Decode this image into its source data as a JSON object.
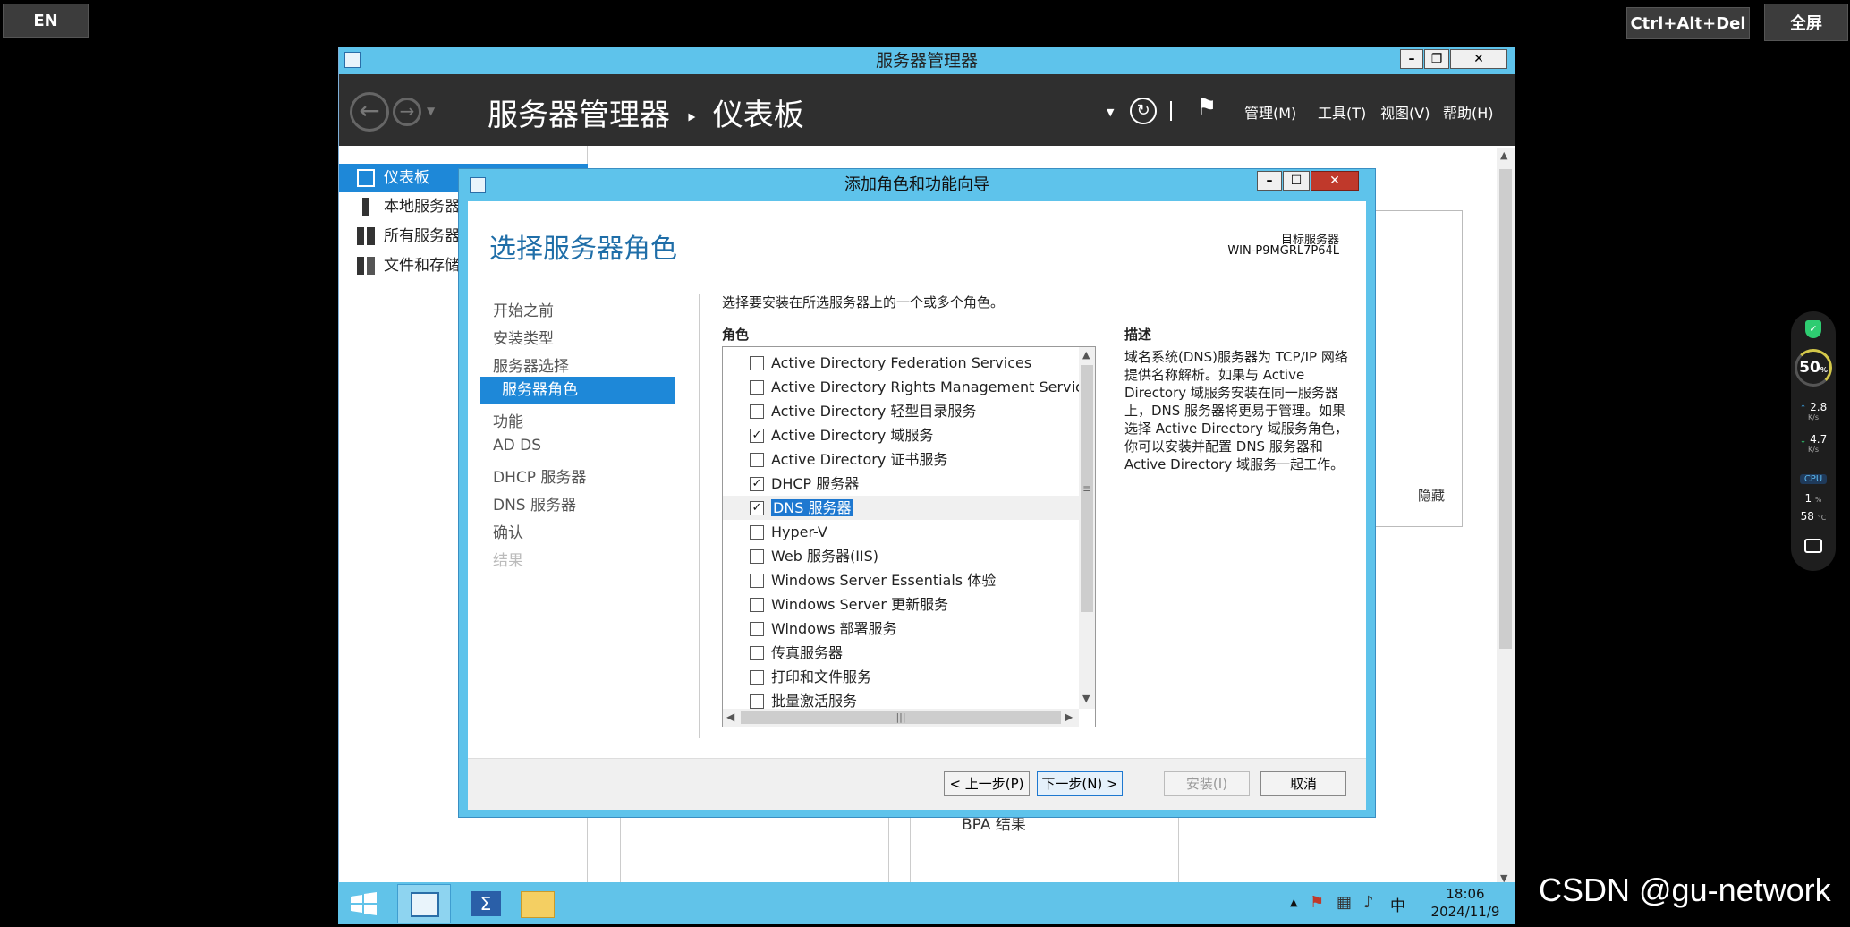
{
  "remote_bar": {
    "lang": "EN",
    "cad": "Ctrl+Alt+Del",
    "fullscreen": "全屏"
  },
  "server_manager": {
    "title": "服务器管理器",
    "breadcrumb_root": "服务器管理器",
    "breadcrumb_sep": "‣",
    "breadcrumb_page": "仪表板",
    "menus": [
      "管理(M)",
      "工具(T)",
      "视图(V)",
      "帮助(H)"
    ],
    "sidebar": [
      "仪表板",
      "本地服务器",
      "所有服务器",
      "文件和存储"
    ],
    "hide_label": "隐藏",
    "bpa_label": "BPA 结果"
  },
  "dialog": {
    "title": "添加角色和功能向导",
    "heading": "选择服务器角色",
    "target_label": "目标服务器",
    "target_value": "WIN-P9MGRL7P64L",
    "steps": [
      "开始之前",
      "安装类型",
      "服务器选择",
      "服务器角色",
      "功能",
      "AD DS",
      "DHCP 服务器",
      "DNS 服务器",
      "确认",
      "结果"
    ],
    "instruction": "选择要安装在所选服务器上的一个或多个角色。",
    "roles_header": "角色",
    "roles": [
      {
        "label": "Active Directory Federation Services",
        "checked": false
      },
      {
        "label": "Active Directory Rights Management Services",
        "checked": false
      },
      {
        "label": "Active Directory 轻型目录服务",
        "checked": false
      },
      {
        "label": "Active Directory 域服务",
        "checked": true
      },
      {
        "label": "Active Directory 证书服务",
        "checked": false
      },
      {
        "label": "DHCP 服务器",
        "checked": true
      },
      {
        "label": "DNS 服务器",
        "checked": true
      },
      {
        "label": "Hyper-V",
        "checked": false
      },
      {
        "label": "Web 服务器(IIS)",
        "checked": false
      },
      {
        "label": "Windows Server Essentials 体验",
        "checked": false
      },
      {
        "label": "Windows Server 更新服务",
        "checked": false
      },
      {
        "label": "Windows 部署服务",
        "checked": false
      },
      {
        "label": "传真服务器",
        "checked": false
      },
      {
        "label": "打印和文件服务",
        "checked": false
      },
      {
        "label": "批量激活服务",
        "checked": false
      }
    ],
    "desc_header": "描述",
    "description": "域名系统(DNS)服务器为 TCP/IP 网络提供名称解析。如果与 Active Directory 域服务安装在同一服务器上，DNS 服务器将更易于管理。如果选择 Active Directory 域服务角色，你可以安装并配置 DNS 服务器和 Active Directory 域服务一起工作。",
    "buttons": {
      "prev": "< 上一步(P)",
      "next": "下一步(N) >",
      "install": "安装(I)",
      "cancel": "取消"
    }
  },
  "taskbar": {
    "time": "18:06",
    "date": "2024/11/9",
    "ime": "中"
  },
  "widget": {
    "percent": "50",
    "pct_unit": "%",
    "up": "2.8",
    "up_unit": "K/s",
    "down": "4.7",
    "down_unit": "K/s",
    "cpu_label": "CPU",
    "cpu_val": "1",
    "cpu_unit": "%",
    "temp_val": "58",
    "temp_unit": "°C"
  },
  "watermark": "CSDN @gu-network"
}
